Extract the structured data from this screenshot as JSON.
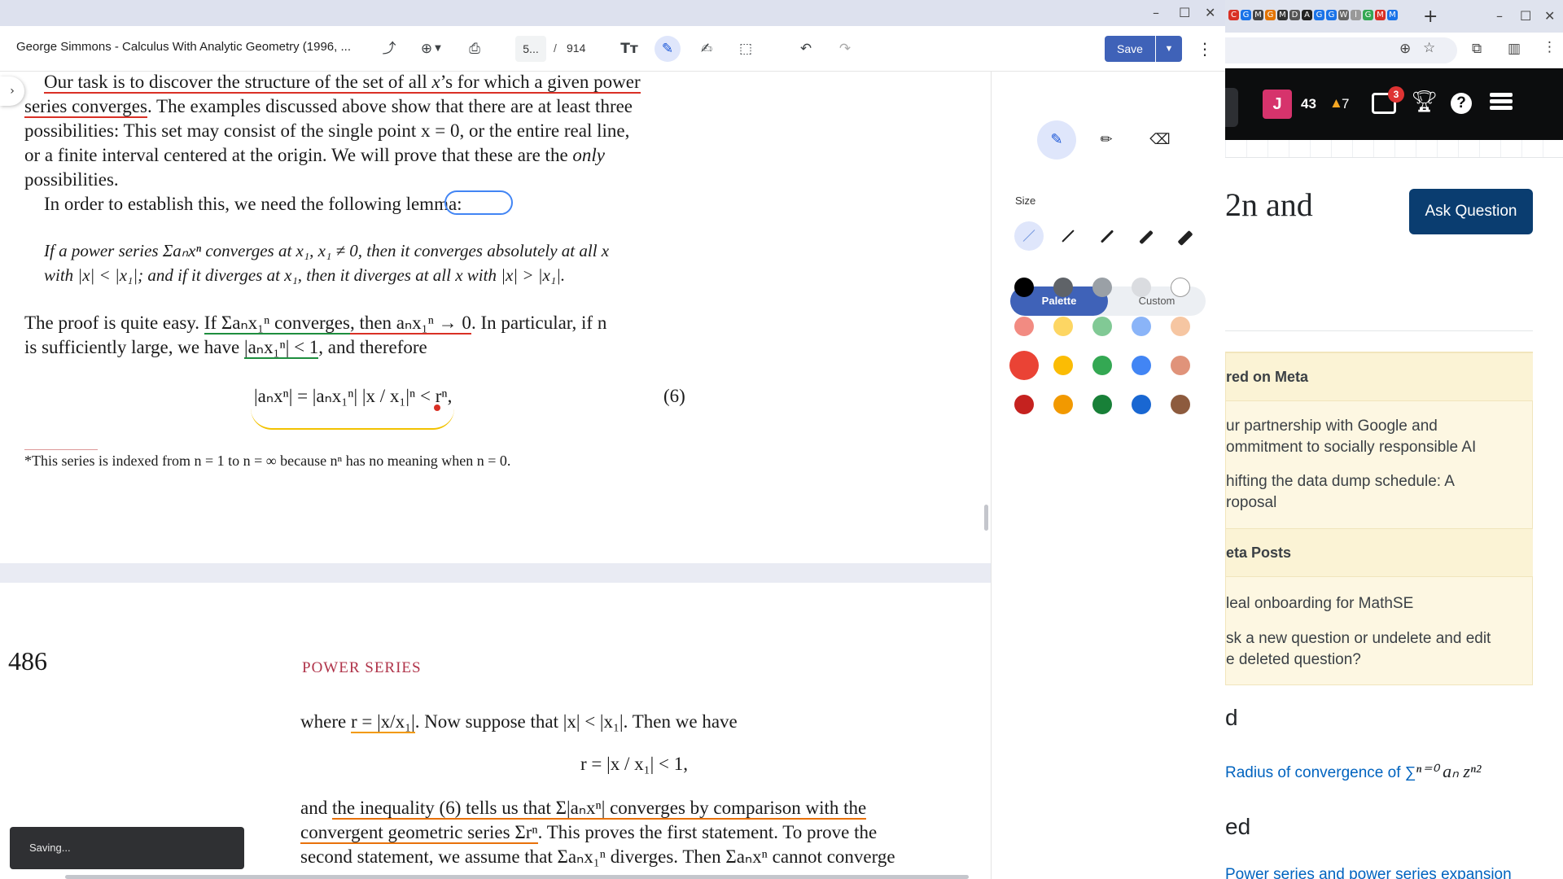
{
  "browser": {
    "favicons": [
      "C",
      "G",
      "M",
      "G",
      "M",
      "D",
      "A",
      "G",
      "G",
      "W",
      "l",
      "G",
      "M",
      "M"
    ],
    "new_tab": "+",
    "user_initial": "J",
    "reputation": "43",
    "bronze_badges": "7",
    "inbox_count": "3",
    "help": "?",
    "question_title_fragment": "2n and",
    "ask_button": "Ask Question",
    "featured_header": "red on Meta",
    "featured_links": [
      "ur partnership with Google and",
      "ommitment to socially responsible AI",
      "hifting the data dump schedule: A",
      "roposal"
    ],
    "hot_meta_header": "eta Posts",
    "meta_links": [
      "leal onboarding for MathSE",
      "sk a new question or undelete and edit",
      "e deleted question?"
    ],
    "linked_heading": "d",
    "linked_question": "Radius of convergence of ∑",
    "related_heading": "ed",
    "related_question": "Power series and power series expansion"
  },
  "viewer": {
    "doc_title": "George Simmons - Calculus With Analytic Geometry (1996, ...",
    "current_page": "5...",
    "page_separator": "/",
    "total_pages": "914",
    "save_label": "Save",
    "toast": "Saving..."
  },
  "pdf": {
    "para1_line1_a": "Our task is to discover the structure of the set of all ",
    "para1_line1_b": "x",
    "para1_line1_c": "’s for which a given power",
    "para1_line2_a": "series converges",
    "para1_line2_b": ". The examples discussed above show that there are at least three",
    "para1_line3": "possibilities: This set may consist of the single point x = 0, or the entire real line,",
    "para1_line4_a": "or a finite interval centered at the origin. We will prove that these are the ",
    "para1_line4_b": "only",
    "para1_line5": "possibilities.",
    "para2_a": "In order to establish this, we need the following ",
    "para2_b": "lemma:",
    "lemma_line1": "If a power series Σaₙxⁿ converges at x₁, x₁ ≠ 0, then it converges absolutely at all x",
    "lemma_line2": "with |x| < |x₁|; and if it diverges at x₁, then it diverges at all x with |x| > |x₁|.",
    "proof_line1_a": "The proof is quite easy. ",
    "proof_line1_b": "If Σaₙx₁ⁿ converges",
    "proof_line1_c": ", then aₙx₁ⁿ → 0",
    "proof_line1_d": ". In particular, if n",
    "proof_line2_a": "is sufficiently large, we have ",
    "proof_line2_b": "|aₙx₁ⁿ| < 1",
    "proof_line2_c": ", and therefore",
    "equation6": "|aₙxⁿ| = |aₙx₁ⁿ| |x / x₁|ⁿ < rⁿ,",
    "eq_number": "(6)",
    "footnote": "*This series is indexed from n = 1 to n = ∞ because nⁿ has no meaning when n = 0.",
    "page_number": "486",
    "running_head": "POWER SERIES",
    "p2_line1_a": "where ",
    "p2_line1_b": "r = |x/x₁|",
    "p2_line1_c": ". Now suppose that |x| < |x₁|. Then we have",
    "p2_eq": "r = |x / x₁| < 1,",
    "p2_line2_a": "and ",
    "p2_line2_b": "the inequality (6) tells us that Σ|aₙxⁿ| converges by comparison with the",
    "p2_line3_a": "convergent geometric series Σrⁿ",
    "p2_line3_b": ". This proves the first statement. To prove the",
    "p2_line4": "second statement, we assume that Σaₙx₁ⁿ diverges. Then Σaₙxⁿ cannot converge"
  },
  "panel": {
    "size_label": "Size",
    "palette_label": "Palette",
    "custom_label": "Custom",
    "swatches": [
      "#000000",
      "#5f6368",
      "#9aa0a6",
      "#dadce0",
      "#ffffff",
      "#f28b82",
      "#fdd663",
      "#81c995",
      "#8ab4f8",
      "#f6c6a2",
      "#ea4335",
      "#fbbc04",
      "#34a853",
      "#4285f4",
      "#e0937a",
      "#c5221f",
      "#f29900",
      "#188038",
      "#1967d2",
      "#8d5b3e"
    ],
    "selected_swatch_index": 10
  }
}
